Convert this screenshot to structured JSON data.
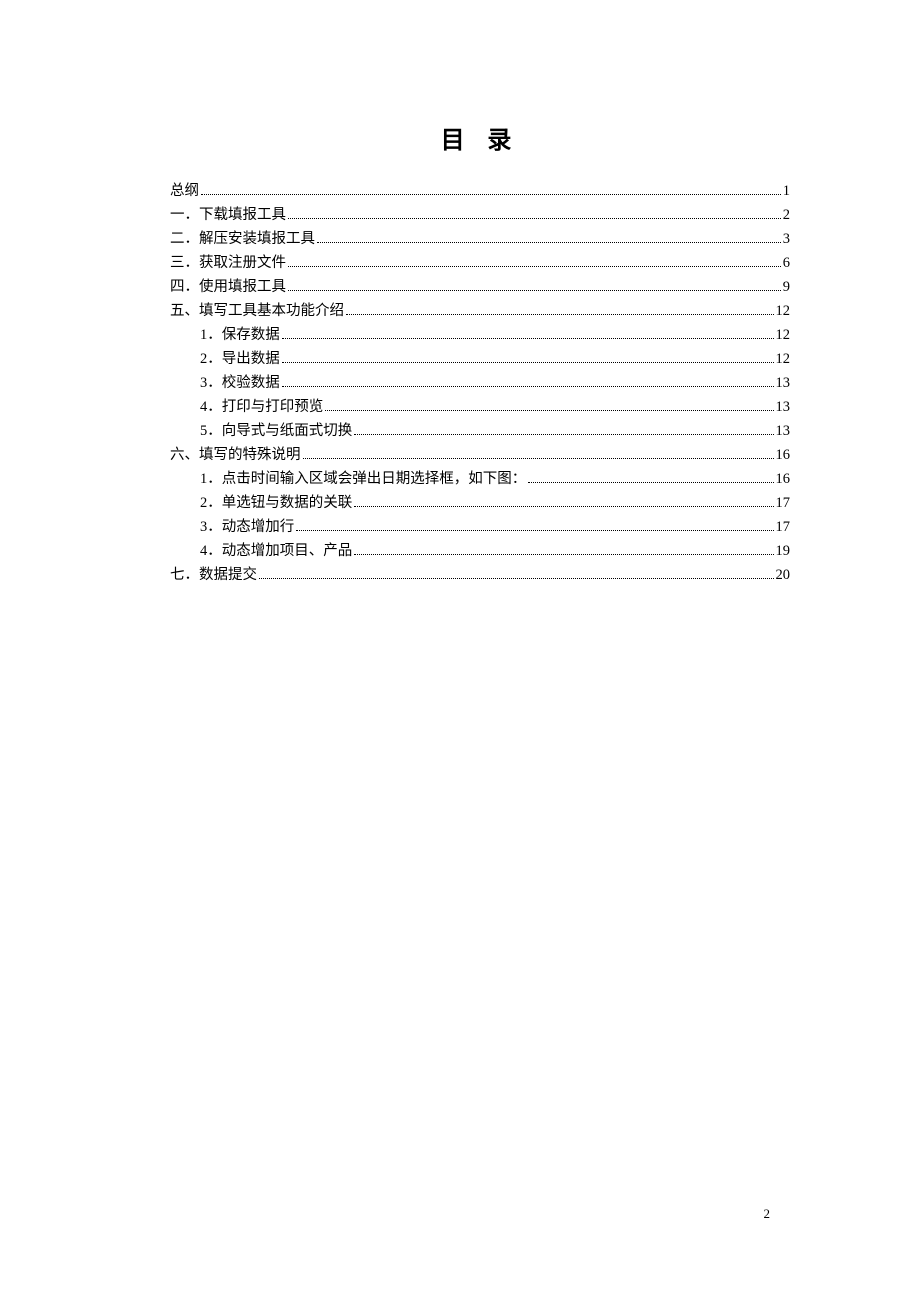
{
  "title": "目 录",
  "pageNumber": "2",
  "toc": [
    {
      "level": 0,
      "label": "总纲",
      "page": "1"
    },
    {
      "level": 0,
      "label": "一．下载填报工具",
      "page": "2"
    },
    {
      "level": 0,
      "label": "二．解压安装填报工具",
      "page": "3"
    },
    {
      "level": 0,
      "label": "三．获取注册文件",
      "page": "6"
    },
    {
      "level": 0,
      "label": "四．使用填报工具",
      "page": "9"
    },
    {
      "level": 0,
      "label": "五、填写工具基本功能介绍",
      "page": "12"
    },
    {
      "level": 1,
      "label": "1．保存数据",
      "page": "12"
    },
    {
      "level": 1,
      "label": "2．导出数据",
      "page": "12"
    },
    {
      "level": 1,
      "label": "3．校验数据",
      "page": "13"
    },
    {
      "level": 1,
      "label": "4．打印与打印预览",
      "page": "13"
    },
    {
      "level": 1,
      "label": "5．向导式与纸面式切换",
      "page": "13"
    },
    {
      "level": 0,
      "label": "六、填写的特殊说明",
      "page": "16"
    },
    {
      "level": 1,
      "label": "1．点击时间输入区域会弹出日期选择框，如下图：",
      "page": "16"
    },
    {
      "level": 1,
      "label": "2．单选钮与数据的关联",
      "page": "17"
    },
    {
      "level": 1,
      "label": "3．动态增加行",
      "page": "17"
    },
    {
      "level": 1,
      "label": "4．动态增加项目、产品",
      "page": "19"
    },
    {
      "level": 0,
      "label": "七．数据提交",
      "page": "20"
    }
  ]
}
